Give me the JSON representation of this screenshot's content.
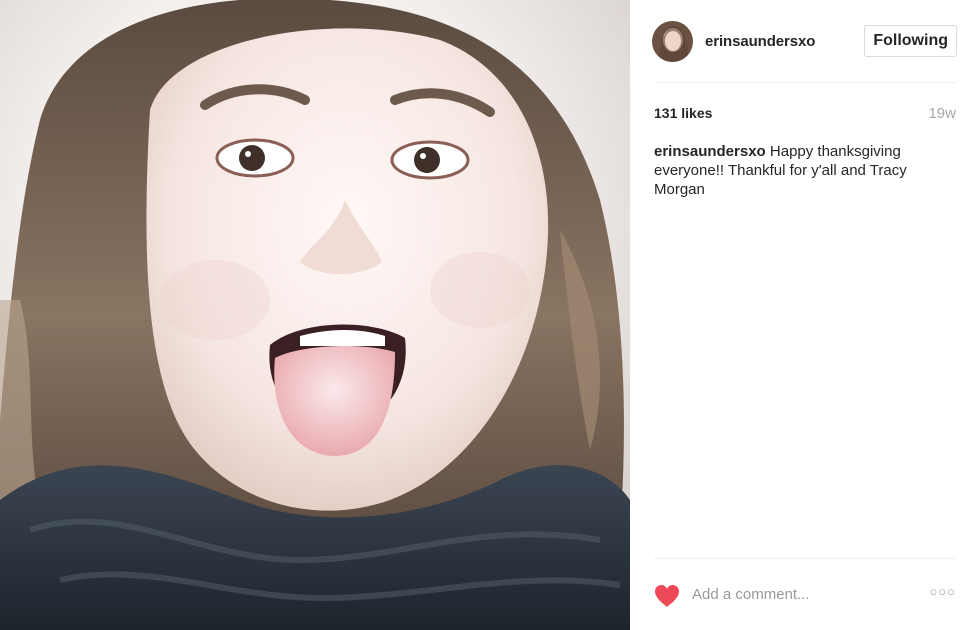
{
  "post": {
    "photo_alt": "selfie photo",
    "header": {
      "username": "erinsaundersxo",
      "follow_label": "Following"
    },
    "stats": {
      "likes": "131 likes",
      "age": "19w"
    },
    "caption": {
      "username": "erinsaundersxo",
      "text": "Happy thanksgiving everyone!! Thankful for y'all and Tracy Morgan"
    },
    "footer": {
      "comment_placeholder": "Add a comment...",
      "more_glyph": "○○○",
      "heart_icon": "heart-icon",
      "heart_color": "#ed4956"
    }
  }
}
